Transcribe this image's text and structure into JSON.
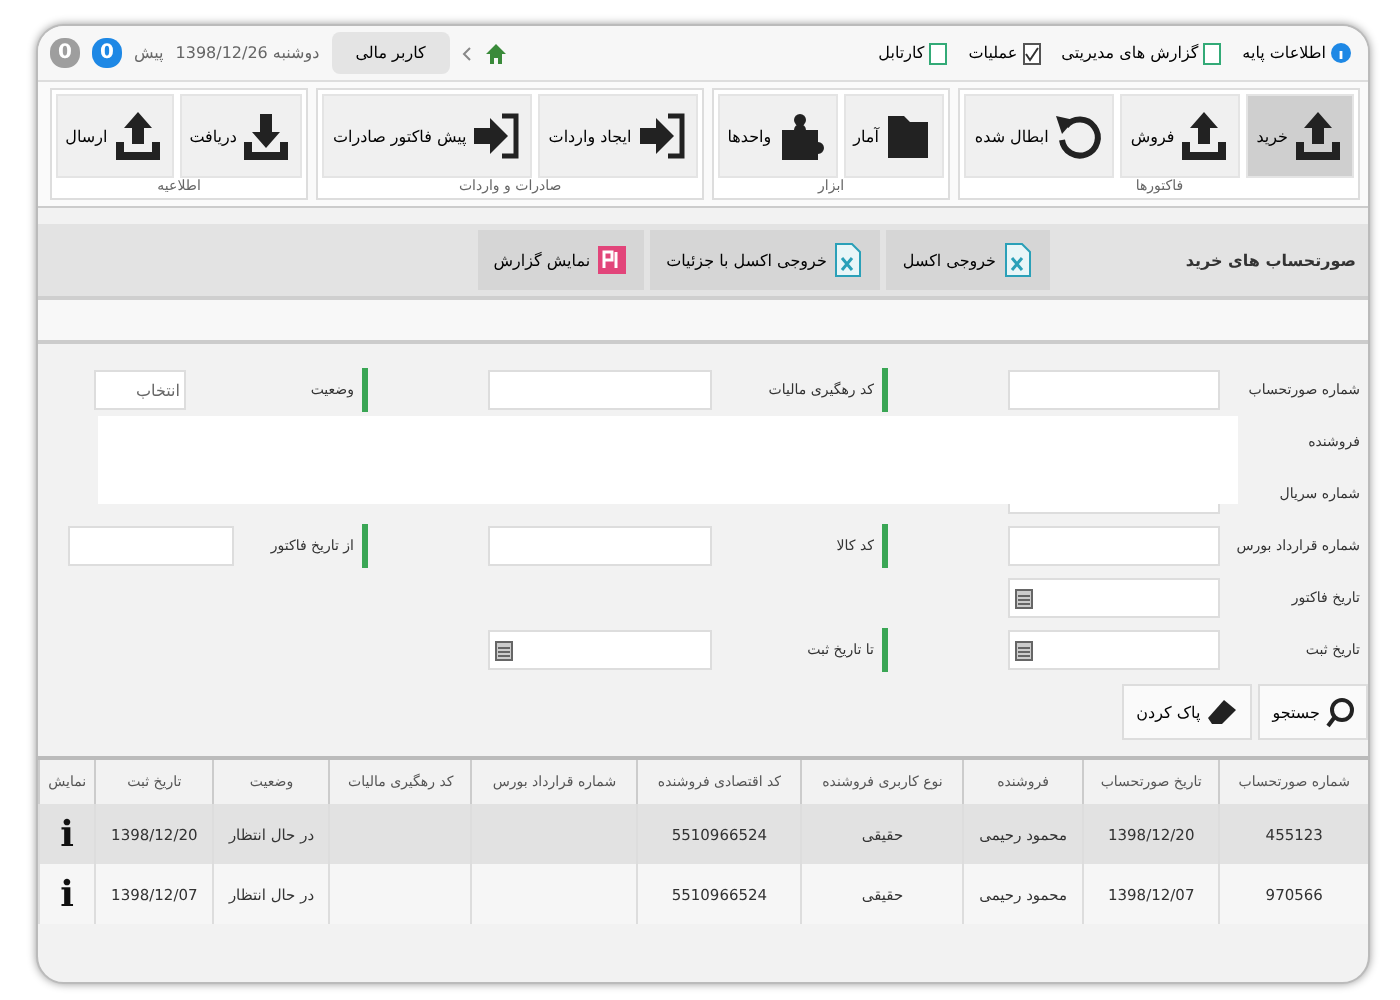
{
  "menu": {
    "items": [
      {
        "label": "اطلاعات پایه"
      },
      {
        "label": "گزارش های مدیریتی"
      },
      {
        "label": "عملیات"
      },
      {
        "label": "کارتابل"
      }
    ]
  },
  "status": {
    "tab": "کاربر مالی",
    "date": "دوشنبه 1398/12/26",
    "user": "پیش",
    "badges": [
      {
        "text": "0",
        "color": "#1e88e5"
      },
      {
        "text": "0",
        "color": "#9e9e9e"
      }
    ]
  },
  "ribbon": [
    {
      "title": "فاکتورها",
      "buttons": [
        {
          "label": "خرید",
          "selected": true
        },
        {
          "label": "فروش",
          "selected": false
        },
        {
          "label": "ابطال شده",
          "selected": false
        }
      ]
    },
    {
      "title": "ابزار",
      "buttons": [
        {
          "label": "آمار",
          "selected": false
        },
        {
          "label": "واحدها",
          "selected": false
        }
      ]
    },
    {
      "title": "صادرات و واردات",
      "buttons": [
        {
          "label": "ایجاد واردات",
          "selected": false
        },
        {
          "label": "پیش فاکتور صادرات",
          "selected": false
        }
      ]
    },
    {
      "title": "اطلاعیه",
      "buttons": [
        {
          "label": "دریافت",
          "selected": false
        },
        {
          "label": "ارسال",
          "selected": false
        }
      ]
    }
  ],
  "page": {
    "title": "صورتحساب های خرید",
    "tabs": [
      {
        "label": "خروجی اکسل"
      },
      {
        "label": "خروجی اکسل با جزئیات"
      },
      {
        "label": "نمایش گزارش"
      }
    ]
  },
  "form": {
    "rows": [
      [
        {
          "label": "شماره صورتحساب",
          "kind": "text"
        },
        {
          "label": "کد رهگیری مالیات",
          "kind": "text"
        },
        {
          "label": "وضعیت",
          "kind": "select",
          "value": "انتخاب"
        }
      ],
      [
        {
          "label": "فروشنده",
          "kind": "hidden"
        }
      ],
      [
        {
          "label": "شماره سریال",
          "kind": "text"
        }
      ],
      [
        {
          "label": "شماره قرارداد بورس",
          "kind": "text"
        },
        {
          "label": "کد کالا",
          "kind": "text"
        },
        {
          "label": "از تاریخ فاکتور",
          "kind": "text"
        }
      ],
      [
        {
          "label": "تاریخ فاکتور",
          "kind": "date"
        }
      ],
      [
        {
          "label": "تاریخ ثبت",
          "kind": "date"
        },
        {
          "label": "تا تاریخ ثبت",
          "kind": "date"
        }
      ]
    ],
    "buttons": [
      {
        "label": "جستجو"
      },
      {
        "label": "پاک کردن"
      }
    ]
  },
  "table": {
    "columns": [
      "شماره صورتحساب",
      "تاریخ صورتحساب",
      "فروشنده",
      "نوع کاربری فروشنده",
      "کد اقتصادی فروشنده",
      "شماره قرارداد بورس",
      "کد رهگیری مالیات",
      "وضعیت",
      "تاریخ ثبت",
      "نمایش"
    ],
    "rows": [
      [
        "455123",
        "1398/12/20",
        "محمود رحیمی",
        "حقیقی",
        "5510966524",
        "",
        "",
        "در حال انتظار",
        "1398/12/20",
        "i"
      ],
      [
        "970566",
        "1398/12/07",
        "محمود رحیمی",
        "حقیقی",
        "5510966524",
        "",
        "",
        "در حال انتظار",
        "1398/12/07",
        "i"
      ]
    ]
  }
}
